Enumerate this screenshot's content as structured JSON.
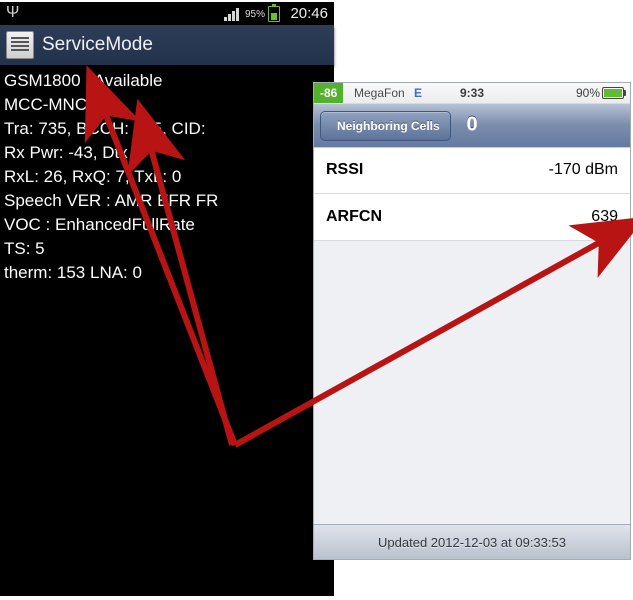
{
  "android": {
    "status": {
      "clock": "20:46",
      "battery_pct": "95%"
    },
    "title": "ServiceMode",
    "lines": {
      "l0": "GSM1800 : Available",
      "l1": "MCC-MNC :",
      "l2": "Tra: 735, BCCH: 735, CID:",
      "l3": "Rx Pwr: -43, Dtx",
      "l4": "RxL: 26, RxQ: 7, TxL: 0",
      "l5": "Speech VER : AMR EFR FR",
      "l6": "VOC : EnhancedFullRate",
      "l7": "TS: 5",
      "l8": "therm: 153 LNA: 0"
    }
  },
  "ios": {
    "status": {
      "dbm": "-86",
      "carrier": "MegaFon",
      "network": "E",
      "clock": "9:33",
      "battery_pct": "90%"
    },
    "nav": {
      "back_label": "Neighboring Cells",
      "title": "0"
    },
    "rows": {
      "rssi": {
        "label": "RSSI",
        "value": "-170 dBm"
      },
      "arfcn": {
        "label": "ARFCN",
        "value": "639"
      }
    },
    "footer": "Updated 2012-12-03 at 09:33:53"
  }
}
